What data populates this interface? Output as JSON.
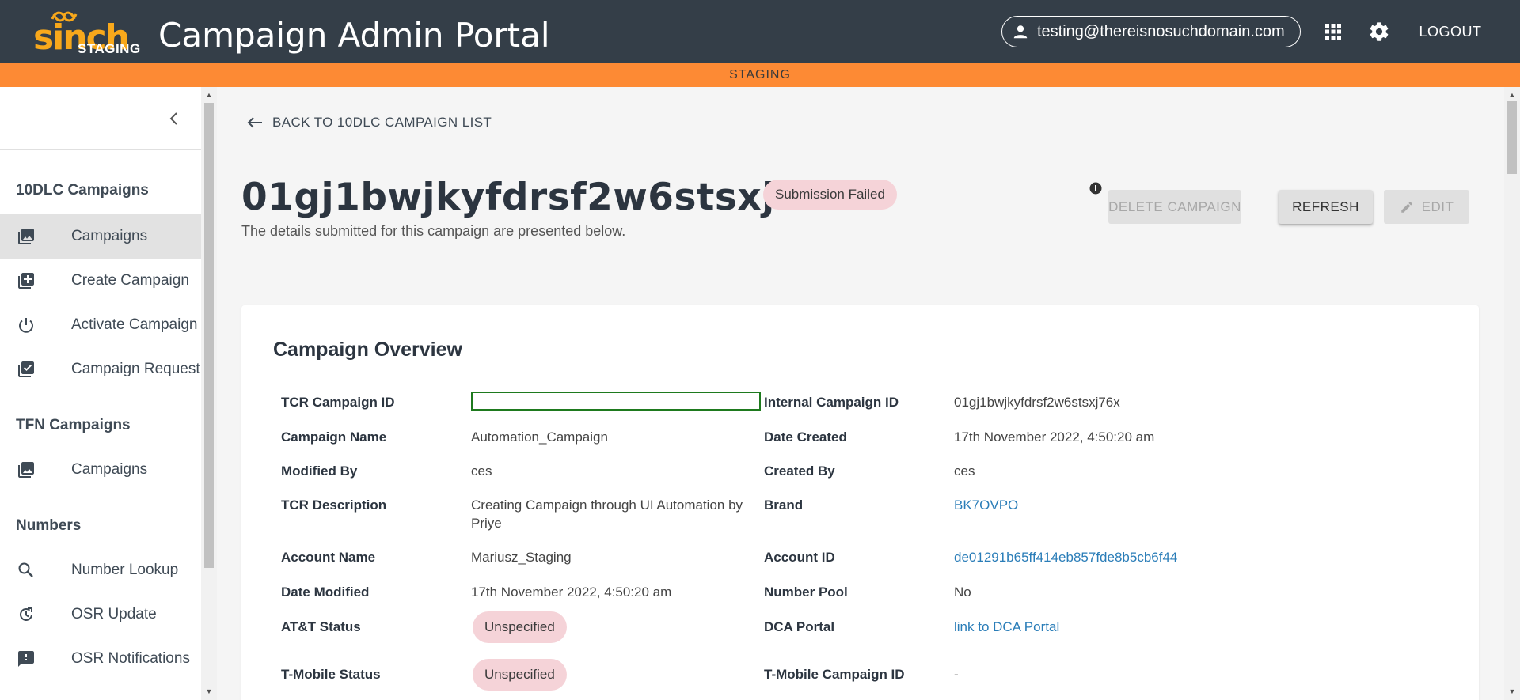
{
  "header": {
    "logo_word": "sinch",
    "logo_sub": "STAGING",
    "app_title": "Campaign Admin Portal",
    "user_email": "testing@thereisnosuchdomain.com",
    "logout_label": "LOGOUT",
    "colors": {
      "header_bg": "#343e48",
      "logo": "#f8a81b"
    }
  },
  "env_banner": {
    "label": "STAGING",
    "color": "#fd8a34"
  },
  "sidebar": {
    "sections": [
      {
        "title": "10DLC Campaigns",
        "items": [
          {
            "label": "Campaigns",
            "icon": "photo-library-icon",
            "active": true
          },
          {
            "label": "Create Campaign",
            "icon": "library-add-icon"
          },
          {
            "label": "Activate Campaign",
            "icon": "power-icon"
          },
          {
            "label": "Campaign Request",
            "icon": "library-check-icon"
          }
        ]
      },
      {
        "title": "TFN Campaigns",
        "items": [
          {
            "label": "Campaigns",
            "icon": "photo-library-icon"
          }
        ]
      },
      {
        "title": "Numbers",
        "items": [
          {
            "label": "Number Lookup",
            "icon": "search-icon"
          },
          {
            "label": "OSR Update",
            "icon": "update-icon"
          },
          {
            "label": "OSR Notifications",
            "icon": "feedback-icon"
          }
        ]
      }
    ]
  },
  "page": {
    "back_label": "BACK TO 10DLC CAMPAIGN LIST",
    "campaign_id_title": "01gj1bwjkyfdrsf2w6stsxj76x",
    "status_badge": "Submission Failed",
    "subtitle": "The details submitted for this campaign are presented below.",
    "buttons": {
      "delete": "DELETE CAMPAIGN",
      "refresh": "REFRESH",
      "edit": "EDIT"
    }
  },
  "overview": {
    "title": "Campaign Overview",
    "left": [
      {
        "label": "TCR Campaign ID",
        "value": ""
      },
      {
        "label": "Campaign Name",
        "value": "Automation_Campaign"
      },
      {
        "label": "Modified By",
        "value": "ces"
      },
      {
        "label": "TCR Description",
        "value": "Creating Campaign through UI Automation by Priye"
      },
      {
        "label": "Account Name",
        "value": "Mariusz_Staging"
      },
      {
        "label": "Date Modified",
        "value": "17th November 2022, 4:50:20 am"
      },
      {
        "label": "AT&T Status",
        "value": "Unspecified"
      },
      {
        "label": "T-Mobile Status",
        "value": "Unspecified"
      }
    ],
    "right": [
      {
        "label": "Internal Campaign ID",
        "value": "01gj1bwjkyfdrsf2w6stsxj76x"
      },
      {
        "label": "Date Created",
        "value": "17th November 2022, 4:50:20 am"
      },
      {
        "label": "Created By",
        "value": "ces"
      },
      {
        "label": "Brand",
        "value": "BK7OVPO"
      },
      {
        "label": "Account ID",
        "value": "de01291b65ff414eb857fde8b5cb6f44"
      },
      {
        "label": "Number Pool",
        "value": "No"
      },
      {
        "label": "DCA Portal",
        "value": "link to DCA Portal"
      },
      {
        "label": "T-Mobile Campaign ID",
        "value": "-"
      }
    ]
  }
}
